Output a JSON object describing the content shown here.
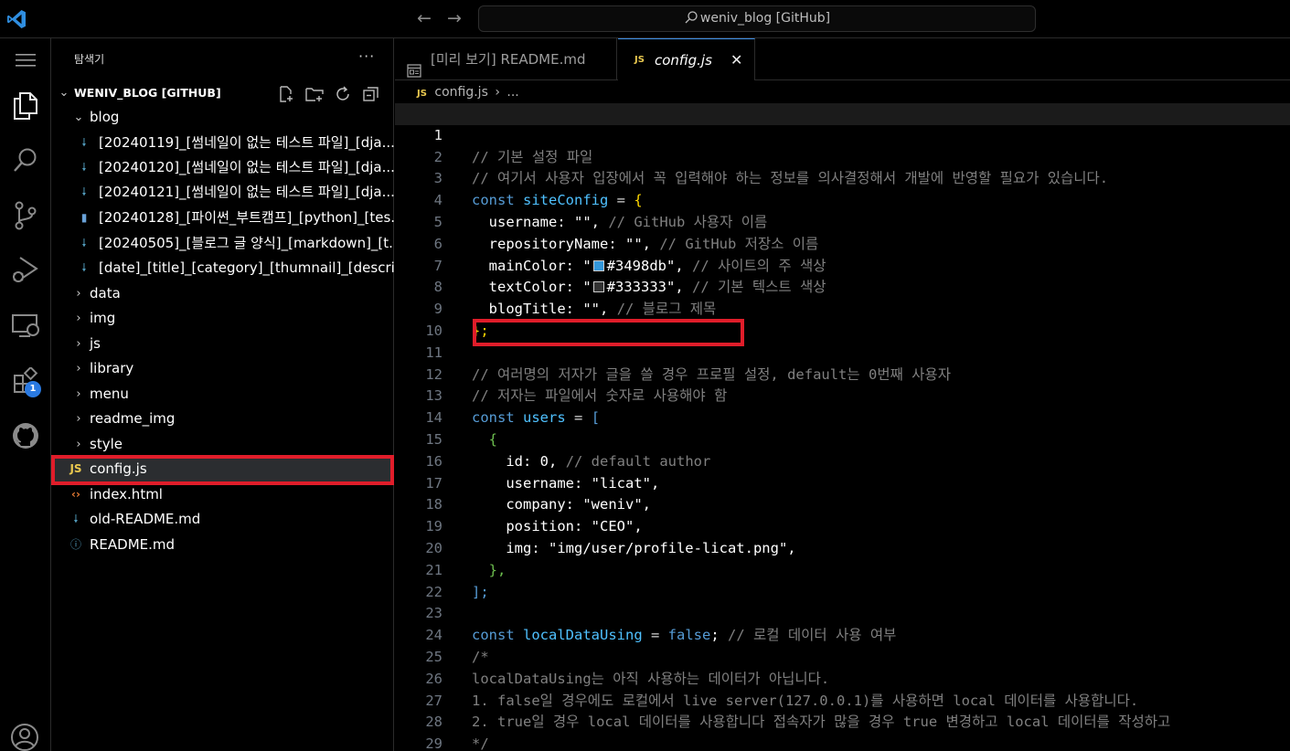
{
  "titlebar": {
    "search": "weniv_blog [GitHub]"
  },
  "activity": {
    "extensions_badge": "1"
  },
  "sidebar": {
    "title": "탐색기",
    "more": "···",
    "root": "WENIV_BLOG [GITHUB]",
    "items": [
      {
        "label": "blog",
        "type": "folder-open"
      },
      {
        "label": "[20240119]_[썸네일이 없는 테스트 파일]_[dja...",
        "type": "md"
      },
      {
        "label": "[20240120]_[썸네일이 없는 테스트 파일]_[dja...",
        "type": "md"
      },
      {
        "label": "[20240121]_[썸네일이 없는 테스트 파일]_[dja...",
        "type": "md"
      },
      {
        "label": "[20240128]_[파이썬_부트캠프]_[python]_[tes...",
        "type": "py"
      },
      {
        "label": "[20240505]_[블로그 글 양식]_[markdown]_[t...",
        "type": "md"
      },
      {
        "label": "[date]_[title]_[category]_[thumnail]_[descrip...",
        "type": "md"
      },
      {
        "label": "data",
        "type": "folder"
      },
      {
        "label": "img",
        "type": "folder"
      },
      {
        "label": "js",
        "type": "folder"
      },
      {
        "label": "library",
        "type": "folder"
      },
      {
        "label": "menu",
        "type": "folder"
      },
      {
        "label": "readme_img",
        "type": "folder"
      },
      {
        "label": "style",
        "type": "folder"
      },
      {
        "label": "config.js",
        "type": "js"
      },
      {
        "label": "index.html",
        "type": "html"
      },
      {
        "label": "old-README.md",
        "type": "md"
      },
      {
        "label": "README.md",
        "type": "info"
      }
    ]
  },
  "editor": {
    "tabs": [
      {
        "label": "[미리 보기] README.md"
      },
      {
        "label": "config.js",
        "close": "✕"
      }
    ],
    "breadcrumb": {
      "file": "config.js",
      "sep": "›",
      "more": "..."
    },
    "js_badge": "JS",
    "colors": {
      "main": "#3498db",
      "text": "#333333",
      "highlight": "#e01d2a"
    }
  },
  "code": {
    "line_numbers": [
      "1",
      "2",
      "3",
      "4",
      "5",
      "6",
      "7",
      "8",
      "9",
      "10",
      "11",
      "12",
      "13",
      "14",
      "15",
      "16",
      "17",
      "18",
      "19",
      "20",
      "21",
      "22",
      "23",
      "24",
      "25",
      "26",
      "27",
      "28",
      "29"
    ],
    "l1": "// 기본 설정 파일",
    "l2": "// 여기서 사용자 입장에서 꼭 입력해야 하는 정보를 의사결정해서 개발에 반영할 필요가 있습니다.",
    "l3": {
      "kw": "const",
      "name": "siteConfig",
      "eq": " = ",
      "brace": "{"
    },
    "l4": {
      "key": "username",
      "val": "\"\"",
      "comment": "// GitHub 사용자 이름"
    },
    "l5": {
      "key": "repositoryName",
      "val": "\"\"",
      "comment": "// GitHub 저장소 이름"
    },
    "l6": {
      "key": "mainColor",
      "val": "#3498db",
      "comment": "// 사이트의 주 색상"
    },
    "l7": {
      "key": "textColor",
      "val": "#333333",
      "comment": "// 기본 텍스트 색상"
    },
    "l8": {
      "key": "blogTitle",
      "val": "\"\"",
      "comment": "// 블로그 제목"
    },
    "l9": "};",
    "l11": "// 여러명의 저자가 글을 쓸 경우 프로필 설정, default는 0번째 사용자",
    "l12": "// 저자는 파일에서 숫자로 사용해야 함",
    "l13": {
      "kw": "const",
      "name": "users",
      "eq": " = ",
      "bracket": "["
    },
    "l14": "{",
    "l15": {
      "key": "id",
      "val": "0",
      "comment": "// default author"
    },
    "l16": {
      "key": "username",
      "val": "\"licat\""
    },
    "l17": {
      "key": "company",
      "val": "\"weniv\""
    },
    "l18": {
      "key": "position",
      "val": "\"CEO\""
    },
    "l19": {
      "key": "img",
      "val": "\"img/user/profile-licat.png\""
    },
    "l20": "},",
    "l21": "];",
    "l23": {
      "kw": "const",
      "name": "localDataUsing",
      "eq": " = ",
      "val": "false",
      "comment": "// 로컬 데이터 사용 여부"
    },
    "l24": "/*",
    "l25": "localDataUsing는 아직 사용하는 데이터가 아닙니다.",
    "l26": "1. false일 경우에도 로컬에서 live server(127.0.0.1)를 사용하면 local 데이터를 사용합니다.",
    "l27": "2. true일 경우 local 데이터를 사용합니다 접속자가 많을 경우 true 변경하고 local 데이터를 작성하고",
    "l28": "*/"
  }
}
